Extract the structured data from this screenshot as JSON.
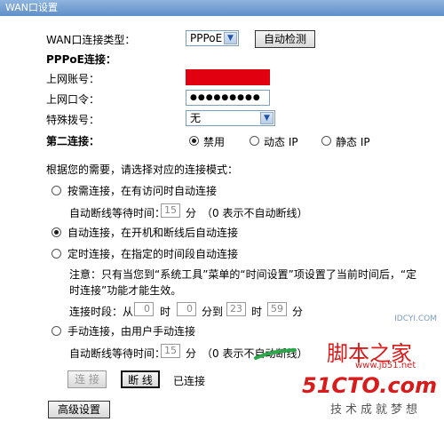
{
  "window": {
    "title": "WAN口设置"
  },
  "wan": {
    "type_label": "WAN口连接类型：",
    "type_value": "PPPoE",
    "detect_button": "自动检测"
  },
  "pppoe": {
    "section_title": "PPPoE连接：",
    "account_label": "上网账号：",
    "password_label": "上网口令：",
    "password_value": "●●●●●●●●●",
    "dial_label": "特殊拨号：",
    "dial_value": "无"
  },
  "second": {
    "label": "第二连接：",
    "options": [
      "禁用",
      "动态 IP",
      "静态 IP"
    ],
    "selected": 0
  },
  "mode": {
    "prompt": "根据您的需要，请选择对应的连接模式：",
    "on_demand": "按需连接，在有访问时自动连接",
    "idle_label": "自动断线等待时间：",
    "idle_value": "15",
    "idle_unit": "分",
    "idle_hint": "（0 表示不自动断线）",
    "auto": "自动连接，在开机和断线后自动连接",
    "timed": "定时连接，在指定的时间段自动连接",
    "note_line1": "注意：只有当您到“系统工具”菜单的“时间设置”项设置了当前时间后，“定",
    "note_line2": "时连接”功能才能生效。",
    "period_label": "连接时段：从",
    "from_hour": "0",
    "hour_unit": "时",
    "from_min": "0",
    "to_label": "分到",
    "to_hour": "23",
    "to_min": "59",
    "min_unit": "分",
    "manual": "手动连接，由用户手动连接",
    "idle2_label": "自动断线等待时间：",
    "idle2_value": "15",
    "idle2_unit": "分",
    "idle2_hint": "（0 表示不自动断线）",
    "selected": 1
  },
  "actions": {
    "connect": "连 接",
    "disconnect": "断 线",
    "status": "已连接",
    "advanced": "高级设置"
  },
  "watermarks": {
    "site_top": "IDCYI.COM",
    "brand_cn": "脚本之家",
    "brand_url": "www.jb51.net",
    "brand_51": "51CTO.com",
    "slogan": "技术成就梦想"
  },
  "colors": {
    "title_bar": "#6a98cf",
    "redaction": "#e00010",
    "watermark_red": "#d81b1b"
  }
}
